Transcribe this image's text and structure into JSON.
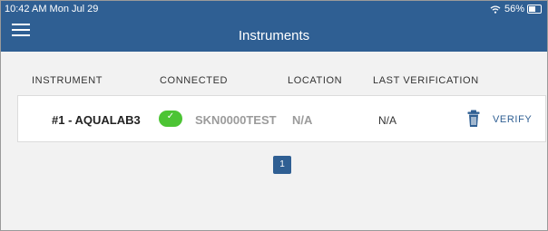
{
  "status_bar": {
    "time": "10:42 AM  Mon Jul 29",
    "battery": "56%"
  },
  "header": {
    "title": "Instruments"
  },
  "table": {
    "columns": [
      "INSTRUMENT",
      "CONNECTED",
      "LOCATION",
      "LAST VERIFICATION"
    ],
    "rows": [
      {
        "instrument": "#1 - AQUALAB3",
        "connected": true,
        "serial": "SKN0000TEST",
        "location": "N/A",
        "last_verification": "N/A",
        "action_label": "VERIFY"
      }
    ]
  },
  "pagination": {
    "current_page": "1"
  },
  "colors": {
    "header_bg": "#2f5f93",
    "toggle_on": "#4cc434",
    "accent": "#2f5f93"
  },
  "icons": {
    "menu": "hamburger-icon",
    "delete": "trash-icon",
    "wifi": "wifi-icon",
    "battery": "battery-icon",
    "check": "check-icon"
  }
}
